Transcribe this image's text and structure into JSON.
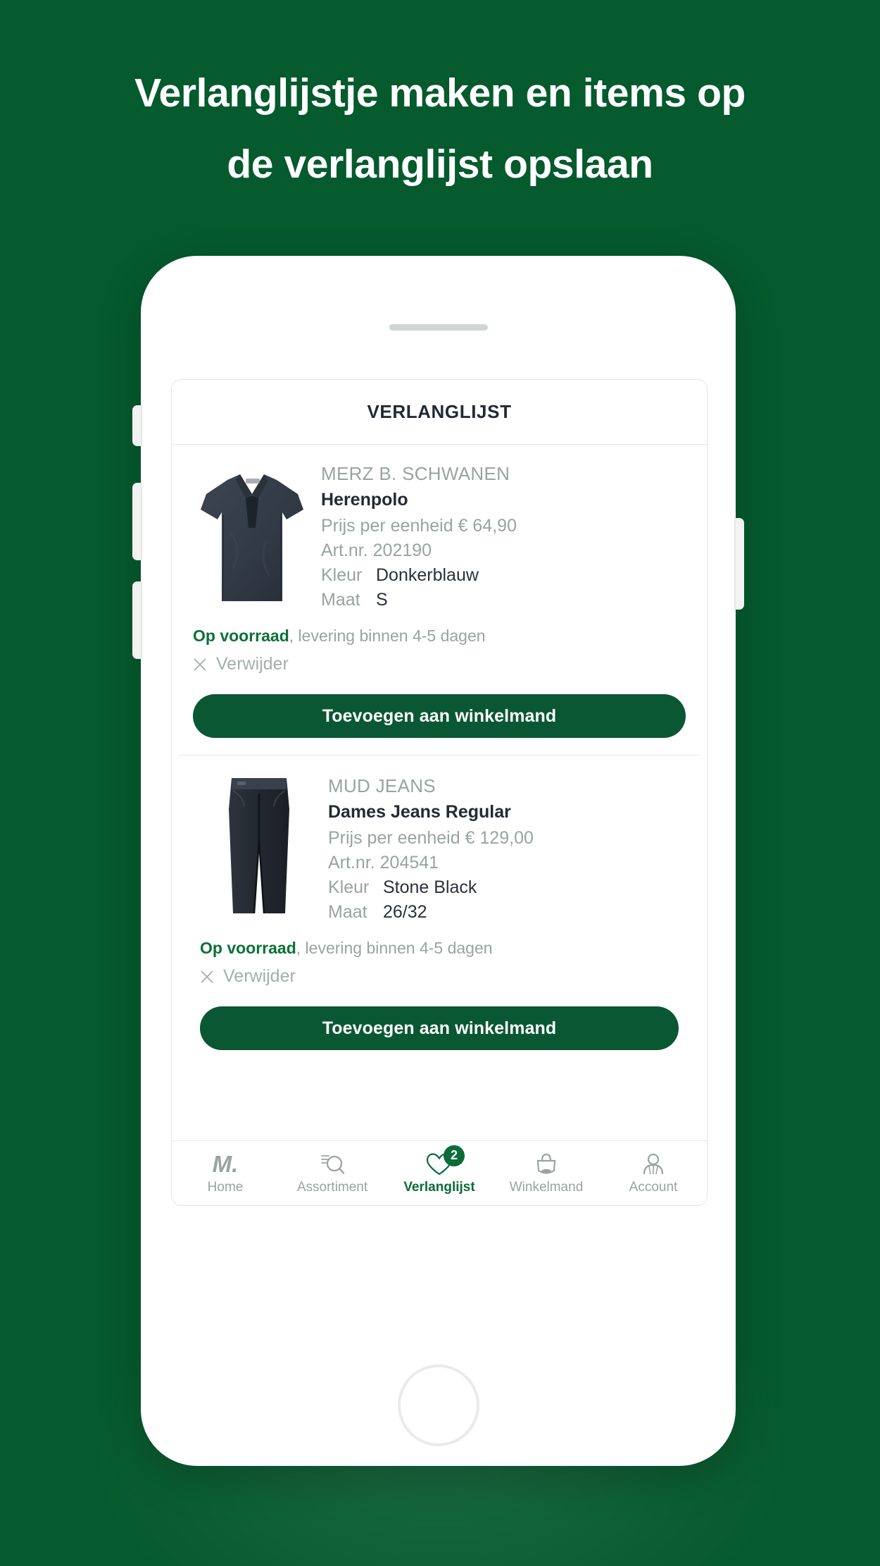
{
  "headline": {
    "line1": "Verlanglijstje maken en items op",
    "line2": "de verlanglijst opslaan"
  },
  "colors": {
    "background_green": "#055A2E",
    "brand_green": "#0A5733",
    "accent_green": "#0B7038",
    "muted_gray": "#9AA3A0",
    "text_dark": "#232A33"
  },
  "screen": {
    "header_title": "VERLANGLIJST",
    "items": [
      {
        "brand": "MERZ B. SCHWANEN",
        "name": "Herenpolo",
        "price_label": "Prijs per eenheid € 64,90",
        "artnr_label": "Art.nr. 202190",
        "color_key": "Kleur",
        "color_value": "Donkerblauw",
        "size_key": "Maat",
        "size_value": "S",
        "stock_strong": "Op voorraad",
        "stock_rest": ", levering binnen 4-5 dagen",
        "remove_label": "Verwijder",
        "cta_label": "Toevoegen aan winkelmand",
        "thumb_icon": "polo-shirt-thumbnail"
      },
      {
        "brand": "MUD JEANS",
        "name": "Dames Jeans Regular",
        "price_label": "Prijs per eenheid € 129,00",
        "artnr_label": "Art.nr. 204541",
        "color_key": "Kleur",
        "color_value": "Stone Black",
        "size_key": "Maat",
        "size_value": "26/32",
        "stock_strong": "Op voorraad",
        "stock_rest": ", levering binnen 4-5 dagen",
        "remove_label": "Verwijder",
        "cta_label": "Toevoegen aan winkelmand",
        "thumb_icon": "jeans-thumbnail"
      }
    ],
    "tabs": [
      {
        "label": "Home",
        "icon": "m-logo-icon",
        "active": false,
        "badge": ""
      },
      {
        "label": "Assortiment",
        "icon": "search-list-icon",
        "active": false,
        "badge": ""
      },
      {
        "label": "Verlanglijst",
        "icon": "heart-icon",
        "active": true,
        "badge": "2"
      },
      {
        "label": "Winkelmand",
        "icon": "shopping-bag-icon",
        "active": false,
        "badge": ""
      },
      {
        "label": "Account",
        "icon": "person-icon",
        "active": false,
        "badge": ""
      }
    ],
    "m_logo_text": "M."
  },
  "device": {
    "speaker": "earpiece-speaker",
    "home_button": "home-button"
  }
}
